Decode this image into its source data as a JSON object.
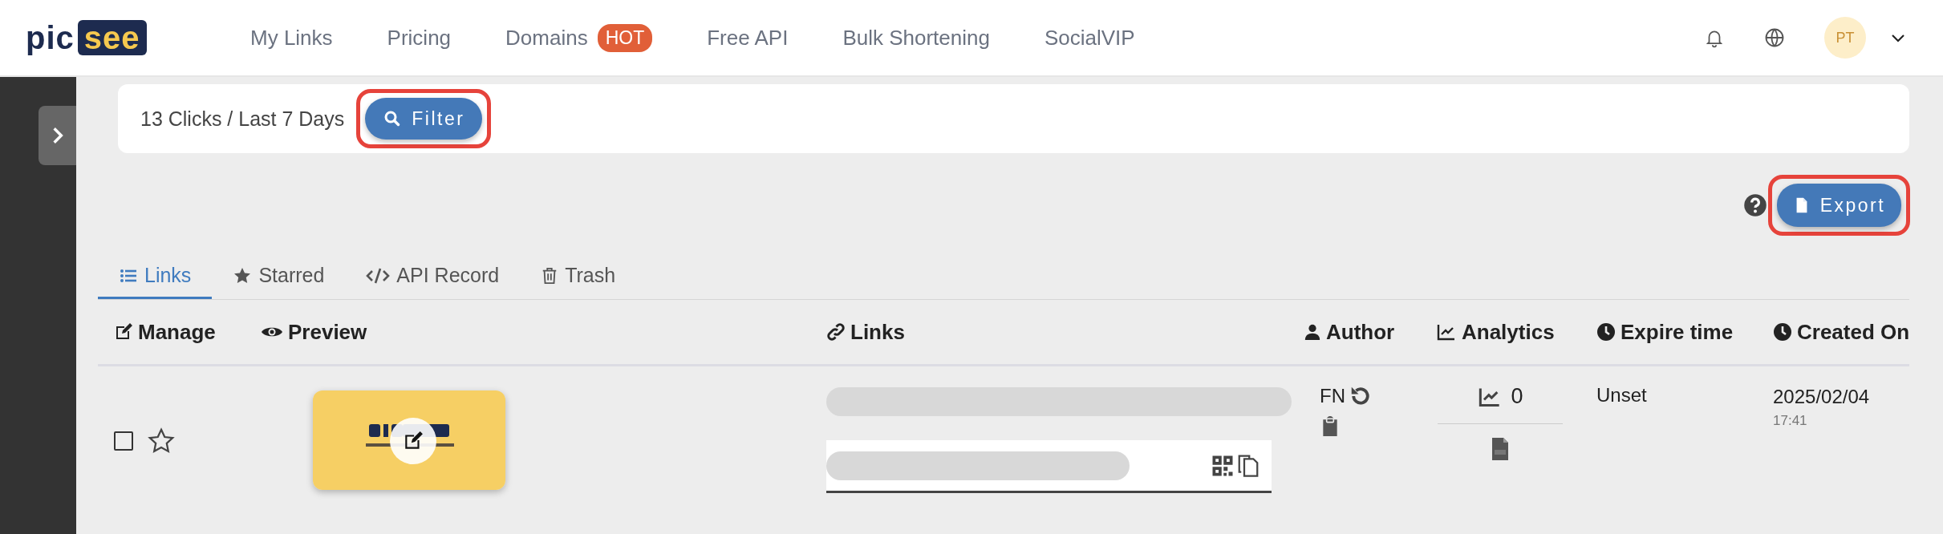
{
  "logo": {
    "dark": "pic",
    "light": "see"
  },
  "nav": [
    {
      "label": "My Links"
    },
    {
      "label": "Pricing"
    },
    {
      "label": "Domains",
      "badge": "HOT"
    },
    {
      "label": "Free API"
    },
    {
      "label": "Bulk Shortening"
    },
    {
      "label": "SocialVIP"
    }
  ],
  "avatar": "PT",
  "summary": "13 Clicks / Last 7 Days",
  "filter_button": {
    "label": "Filter",
    "highlighted": true
  },
  "export_button": {
    "label": "Export",
    "highlighted": true
  },
  "tabs": [
    {
      "label": "Links",
      "selected": true
    },
    {
      "label": "Starred",
      "selected": false
    },
    {
      "label": "API Record",
      "selected": false
    },
    {
      "label": "Trash",
      "selected": false
    }
  ],
  "columns": [
    {
      "label": "Manage"
    },
    {
      "label": "Preview"
    },
    {
      "label": "Links"
    },
    {
      "label": "Author"
    },
    {
      "label": "Analytics"
    },
    {
      "label": "Expire time"
    },
    {
      "label": "Created On"
    }
  ],
  "rows": [
    {
      "checked": false,
      "starred": false,
      "author": "FN",
      "clicks": "0",
      "expire": "Unset",
      "date": "2025/02/04",
      "time": "17:41"
    }
  ]
}
